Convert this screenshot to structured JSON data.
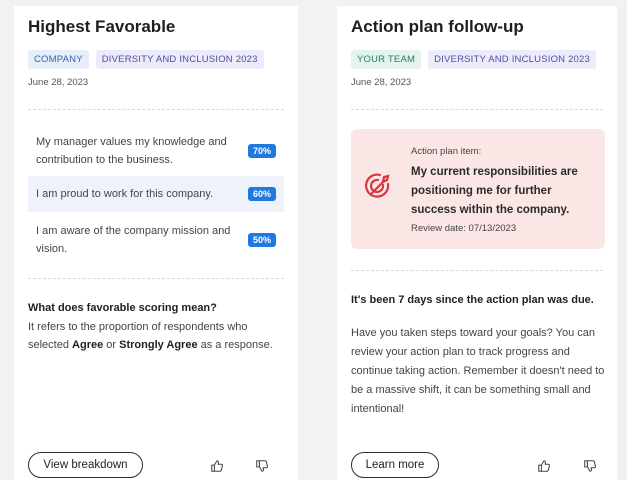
{
  "left_card": {
    "title": "Highest Favorable",
    "tags": [
      "COMPANY",
      "DIVERSITY AND INCLUSION 2023"
    ],
    "date": "June 28, 2023",
    "items": [
      {
        "text": "My manager values my knowledge and contribution to the business.",
        "percent": "70%"
      },
      {
        "text": "I am proud to work for this company.",
        "percent": "60%"
      },
      {
        "text": "I am aware of the company mission and vision.",
        "percent": "50%"
      }
    ],
    "explain_title": "What does favorable scoring mean?",
    "explain_pre": "It refers to the proportion of respondents who selected ",
    "explain_bold1": "Agree",
    "explain_mid": " or ",
    "explain_bold2": "Strongly Agree",
    "explain_post": " as a response.",
    "button_label": "View breakdown",
    "icons": [
      "thumbs-up-icon",
      "thumbs-down-icon"
    ]
  },
  "right_card": {
    "title": "Action plan follow-up",
    "tags": [
      "YOUR TEAM",
      "DIVERSITY AND INCLUSION 2023"
    ],
    "date": "June 28, 2023",
    "action_item_label": "Action plan item:",
    "action_item_title": "My current responsibilities are positioning me for further success within the company.",
    "review_date": "Review date: 07/13/2023",
    "due_title": "It's been 7 days since the action plan was due.",
    "due_body": "Have you taken steps toward your goals? You can review your action plan to track progress and continue taking action. Remember it doesn't need to be a massive shift, it can be something small and intentional!",
    "button_label": "Learn more",
    "icons": [
      "target-icon",
      "thumbs-up-icon",
      "thumbs-down-icon"
    ]
  },
  "colors": {
    "percent_badge": "#1e7ae0",
    "action_box_bg": "#fbe6e6",
    "target_icon": "#d9363e",
    "highlight_row": "#eef3fb"
  }
}
